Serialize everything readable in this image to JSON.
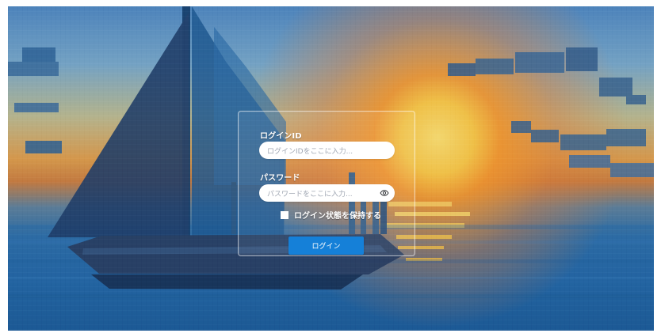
{
  "login": {
    "id_label": "ログインID",
    "id_placeholder": "ログインIDをここに入力...",
    "password_label": "パスワード",
    "password_placeholder": "パスワードをここに入力...",
    "remember_label": "ログイン状態を保持する",
    "submit_label": "ログイン",
    "password_toggle_icon": "eye-icon",
    "remember_checked": false
  },
  "colors": {
    "button": "#1580d8",
    "text": "#ffffff",
    "card_border": "#ffffff"
  }
}
